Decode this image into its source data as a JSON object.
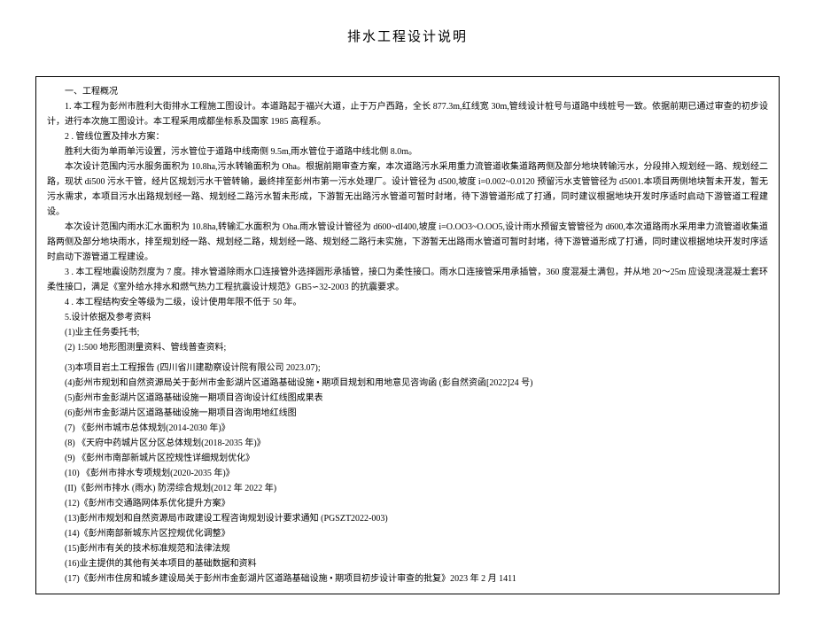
{
  "title": "排水工程设计说明",
  "section1": {
    "header": "一、工程概况",
    "p1": "1. 本工程为彭州市胜利大街排水工程施工图设计。本道路起于福兴大道，止于万户西路，全长 877.3m,红线宽 30m,管线设计桩号与道路中线桩号一致。依据前期已通过审查的初步设计，进行本次施工图设计。本工程采用成都坐标系及国家 1985 高程系。",
    "p2": "2  . 管线位置及排水方案：",
    "p2a": "胜利大街为单雨单污设置，污水管位于道路中线南侧 9.5m,雨水管位于道路中线北侧 8.0m。",
    "p3": "本次设计范围内污水服务面积为 10.8ha,污水转输面积为 Oha。根据前期审查方案，本次道路污水采用重力流管道收集道路两侧及部分地块转输污水，分段排入规划经一路、规划经二路，现状 di500 污水干管，经片区规划污水干管转输，最终排至彭州市第一污水处理厂。设计管径为 d500,坡度 i=0.002~0.0120 预留污水支管管径为 d5001.本项目两侧地块暂未开发，暂无污水需求，本项目污水出路规划经一路、规划经二路污水暂未形成，下游暂无出路污水管道可暂时封堵，待下游管道形成了打通，同时建议根据地块开发时序适时启动下游管道工程建设。",
    "p4": "本次设计范围内雨水汇水面积为 10.8ha,转输汇水面积为 Oha.雨水管设计管径为 d600~dI400,坡度 i=O.OO3~O.OO5,设计雨水预留支管管径为 d600,本次道路雨水采用聿力流管道收集道路两侧及部分地块雨水，排至规划经一路、规划经二路，规划经一路、规划经二路行未实施，下游暂无出路雨水管道可暂时封堵，待下游管道形成了打通，同时建议根据地块开发时序适时启动下游管道工程建设。",
    "p5": "3  . 本工程地震设防烈度为 7 度。排水管道除雨水口连接管外选择圆形承插管，接口为柔性接口。雨水口连接管采用承插管，360 度混凝土满包，并从地 20～25m 应设现浇混凝土套环柔性接口，满足《室外给水排水和燃气热力工程抗震设计规范》GB5∽32-2003 的抗震要求。",
    "p6": "4  . 本工程结构安全等级为二级，设计使用年限不低于 50 年。",
    "p7": "5.设计依据及参考资料",
    "item1": "(1)业主任务委托书;",
    "item2": "(2)   1:500 地形图测量资料、管线普查资料;",
    "item3": "(3)本项目岩土工程报告 (四川省川建勘察设计院有限公司 2023.07);",
    "item4": "(4)彭州市规划和自然资源局关于彭州市金彭湖片区道路基础设施 • 期项目规划和用地意见咨询函 (彭自然资函[2022]24 号)",
    "item5": "(5)彭州市金彭湖片区道路基础设施一期项目咨询设计红线图成果表",
    "item6": "(6)彭州市金彭湖片区道路基础设施一期项目咨询用地红线图",
    "item7": "(7)     《彭州市城市总体规划(2014-2030 年)》",
    "item8": "(8)     《天府中药城片区分区总体规划(2018-2035 年)》",
    "item9": "(9)     《彭州市南部新城片区控规性详细规划优化》",
    "item10": "(10) 《彭州市排水专项规划(2020-2035 年)》",
    "item11": "(II)《彭州市排水 (雨水) 防涝综合规划(2012 年 2022 年)",
    "item12": "(12)《彭州市交通路网体系优化提升方案》",
    "item13": "(13)彭州市规划和自然资源局市政建设工程咨询规划设计要求通知 (PGSZT2022-003)",
    "item14": "(14)《彭州南部新城东片区控规优化调整》",
    "item15": "(15)彭州市有关的技术标准规范和法律法规",
    "item16": "(16)业主提供的其他有关本项目的基础数据和资料",
    "item17": "(17)《彭州市住房和城乡建设局关于彭州市金彭湖片区道路基础设施 • 期项目初步设计审查的批复》2023 年 2 月 1411"
  }
}
